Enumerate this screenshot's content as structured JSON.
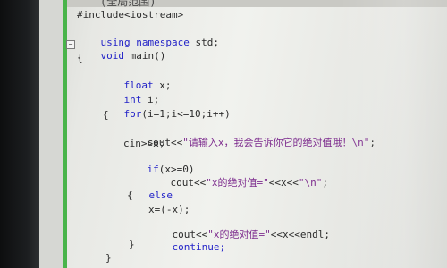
{
  "header_text": "(全局范围)",
  "code_lines": {
    "l1": "#include<iostream>",
    "l2_kw": "using namespace",
    "l2_rest": " std;",
    "l3_kw": "void",
    "l3_rest": " main()",
    "l4": "{",
    "l5_kw": "float",
    "l5_rest": " x;",
    "l6_kw": "int",
    "l6_rest": " i;",
    "l7_kw": "for",
    "l7_rest": "(i=1;i<=10;i++)",
    "l8": "{",
    "l9_a": "cout<<",
    "l9_str": "\"请输入x，我会告诉你它的绝对值哦！\\n\"",
    "l9_b": ";",
    "l10": "cin>>x;",
    "l11_kw": "if",
    "l11_rest": "(x>=0)",
    "l12_a": "cout<<",
    "l12_str": "\"x的绝对值=\"",
    "l12_b": "<<x<<",
    "l12_str2": "\"\\n\"",
    "l12_c": ";",
    "l13_kw": "else",
    "l14": "{",
    "l15": "x=(-x);",
    "l16_a": "cout<<",
    "l16_str": "\"x的绝对值=\"",
    "l16_b": "<<x<<endl;",
    "l17_kw": "continue;",
    "l18": "}",
    "l19": "}"
  },
  "fold_markers": {
    "minus": "−"
  },
  "colors": {
    "keyword": "#2424c8",
    "string": "#7d2c8e",
    "text": "#2b2b2b",
    "change_bar": "#49b44a"
  }
}
